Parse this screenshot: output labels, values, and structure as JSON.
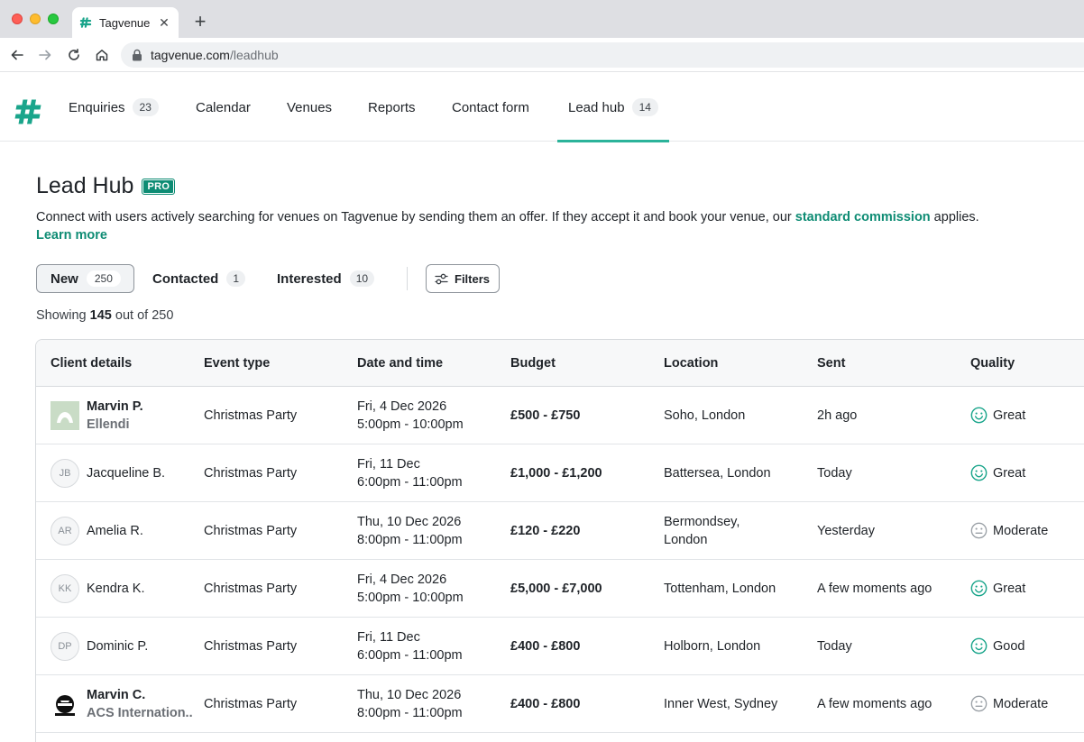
{
  "browser": {
    "tab_title": "Tagvenue",
    "url_host": "tagvenue.com",
    "url_path": "/leadhub"
  },
  "nav": {
    "items": [
      {
        "label": "Enquiries",
        "badge": "23"
      },
      {
        "label": "Calendar"
      },
      {
        "label": "Venues"
      },
      {
        "label": "Reports"
      },
      {
        "label": "Contact form"
      },
      {
        "label": "Lead hub",
        "badge": "14",
        "active": true
      }
    ]
  },
  "page": {
    "title": "Lead Hub",
    "pro_badge": "PRO",
    "desc_before": "Connect with users actively searching for venues on Tagvenue by sending them an offer. If they accept it and book your venue, our ",
    "desc_link": "standard commission",
    "desc_after": " applies.",
    "learn_more": "Learn more"
  },
  "segments": [
    {
      "label": "New",
      "count": "250",
      "selected": true
    },
    {
      "label": "Contacted",
      "count": "1"
    },
    {
      "label": "Interested",
      "count": "10"
    }
  ],
  "filters_label": "Filters",
  "showing": {
    "prefix": "Showing ",
    "count": "145",
    "suffix": " out of 250"
  },
  "table": {
    "headers": [
      "Client details",
      "Event type",
      "Date and time",
      "Budget",
      "Location",
      "Sent",
      "Quality"
    ],
    "rows": [
      {
        "name": "Marvin P.",
        "company": "Ellendi",
        "avatar_type": "image",
        "event": "Christmas Party",
        "date": "Fri, 4 Dec 2026",
        "time": "5:00pm - 10:00pm",
        "budget": "£500 - £750",
        "location": "Soho, London",
        "sent": "2h ago",
        "quality": "Great"
      },
      {
        "name": "Jacqueline B.",
        "initials": "JB",
        "event": "Christmas Party",
        "date": "Fri, 11 Dec",
        "time": "6:00pm - 11:00pm",
        "budget": "£1,000 - £1,200",
        "location": "Battersea, London",
        "sent": "Today",
        "quality": "Great"
      },
      {
        "name": "Amelia R.",
        "initials": "AR",
        "event": "Christmas Party",
        "date": "Thu, 10 Dec 2026",
        "time": "8:00pm - 11:00pm",
        "budget": "£120 - £220",
        "location_line1": "Bermondsey,",
        "location_line2": "London",
        "sent": "Yesterday",
        "quality": "Moderate"
      },
      {
        "name": "Kendra K.",
        "initials": "KK",
        "event": "Christmas Party",
        "date": "Fri, 4 Dec 2026",
        "time": "5:00pm - 10:00pm",
        "budget": "£5,000 - £7,000",
        "location": "Tottenham, London",
        "sent": "A few moments ago",
        "quality": "Great"
      },
      {
        "name": "Dominic P.",
        "initials": "DP",
        "event": "Christmas Party",
        "date": "Fri, 11 Dec",
        "time": "6:00pm - 11:00pm",
        "budget": "£400 - £800",
        "location": "Holborn, London",
        "sent": "Today",
        "quality": "Good"
      },
      {
        "name": "Marvin C.",
        "company": "ACS Internation..",
        "avatar_type": "logo",
        "event": "Christmas Party",
        "date": "Thu, 10 Dec 2026",
        "time": "8:00pm - 11:00pm",
        "budget": "£400 - £800",
        "location": "Inner West, Sydney",
        "sent": "A few moments ago",
        "quality": "Moderate"
      }
    ]
  },
  "colors": {
    "brand": "#0e8c74",
    "tab_underline": "#2bb39a",
    "quality_positive": "#1aa58b",
    "quality_neutral": "#9aa0a6"
  }
}
